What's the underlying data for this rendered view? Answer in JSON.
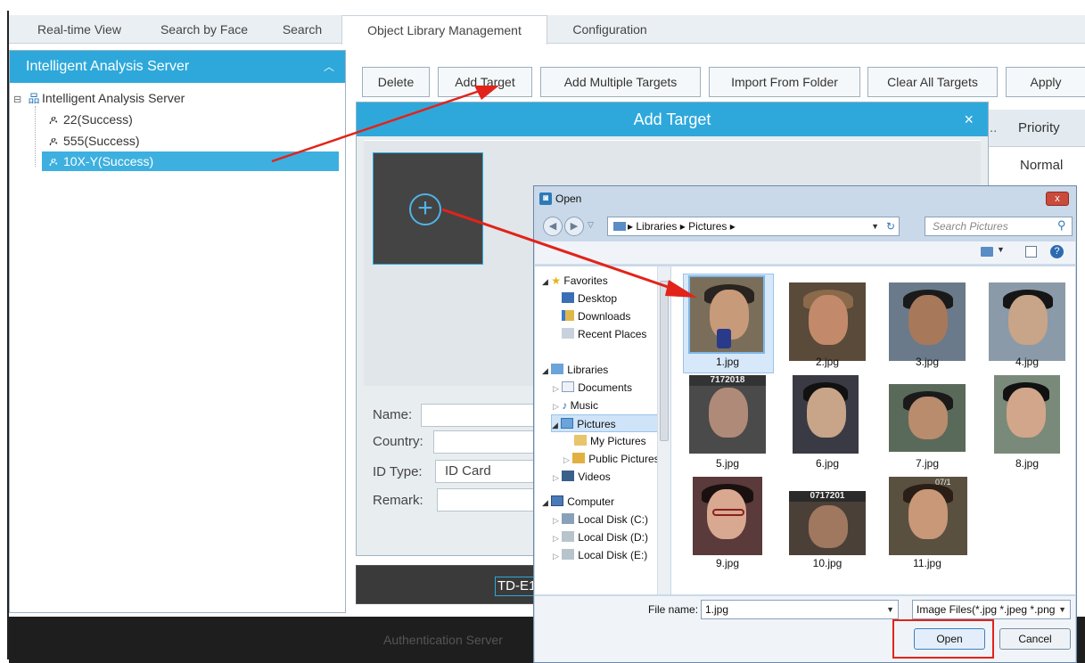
{
  "tabs": [
    "Real-time View",
    "Search by Face",
    "Search",
    "Object Library Management",
    "Configuration"
  ],
  "left_panel": {
    "title": "Intelligent Analysis Server",
    "root": "Intelligent Analysis Server",
    "nodes": [
      "22(Success)",
      "555(Success)",
      "10X-Y(Success)"
    ]
  },
  "toolbar": {
    "delete": "Delete",
    "add_target": "Add Target",
    "add_multiple": "Add Multiple Targets",
    "import_folder": "Import From Folder",
    "clear_all": "Clear All Targets",
    "apply": "Apply"
  },
  "table": {
    "col_trunc": "..",
    "priority_header": "Priority",
    "priority_value": "Normal"
  },
  "add_dialog": {
    "title": "Add Target",
    "close": "×",
    "name_label": "Name:",
    "country_label": "Country:",
    "id_type_label": "ID Type:",
    "id_type_value": "ID Card",
    "remark_label": "Remark:",
    "device": "TD-E1"
  },
  "bottom_bar": {
    "text": "Authentication Server"
  },
  "open_dialog": {
    "title": "Open",
    "close": "x",
    "path": "▸ Libraries ▸ Pictures ▸",
    "search_placeholder": "Search Pictures",
    "nav": {
      "favorites": "Favorites",
      "desktop": "Desktop",
      "downloads": "Downloads",
      "recent": "Recent Places",
      "libraries": "Libraries",
      "documents": "Documents",
      "music": "Music",
      "pictures": "Pictures",
      "my_pictures": "My Pictures",
      "public_pictures": "Public Pictures",
      "videos": "Videos",
      "computer": "Computer",
      "disk_c": "Local Disk (C:)",
      "disk_d": "Local Disk (D:)",
      "disk_e": "Local Disk (E:)"
    },
    "files": [
      "1.jpg",
      "2.jpg",
      "3.jpg",
      "4.jpg",
      "5.jpg",
      "6.jpg",
      "7.jpg",
      "8.jpg",
      "9.jpg",
      "10.jpg",
      "11.jpg"
    ],
    "thumb_overlay_5": "7172018",
    "thumb_overlay_10": "0717201",
    "thumb_overlay_11": "07/1",
    "file_name_label": "File name:",
    "file_name_value": "1.jpg",
    "file_type": "Image Files(*.jpg *.jpeg *.png",
    "open_button": "Open",
    "cancel_button": "Cancel"
  },
  "colors": {
    "accent": "#2ea8db",
    "annotation": "#e2231a",
    "bottom_bar": "#1e1e1e"
  }
}
